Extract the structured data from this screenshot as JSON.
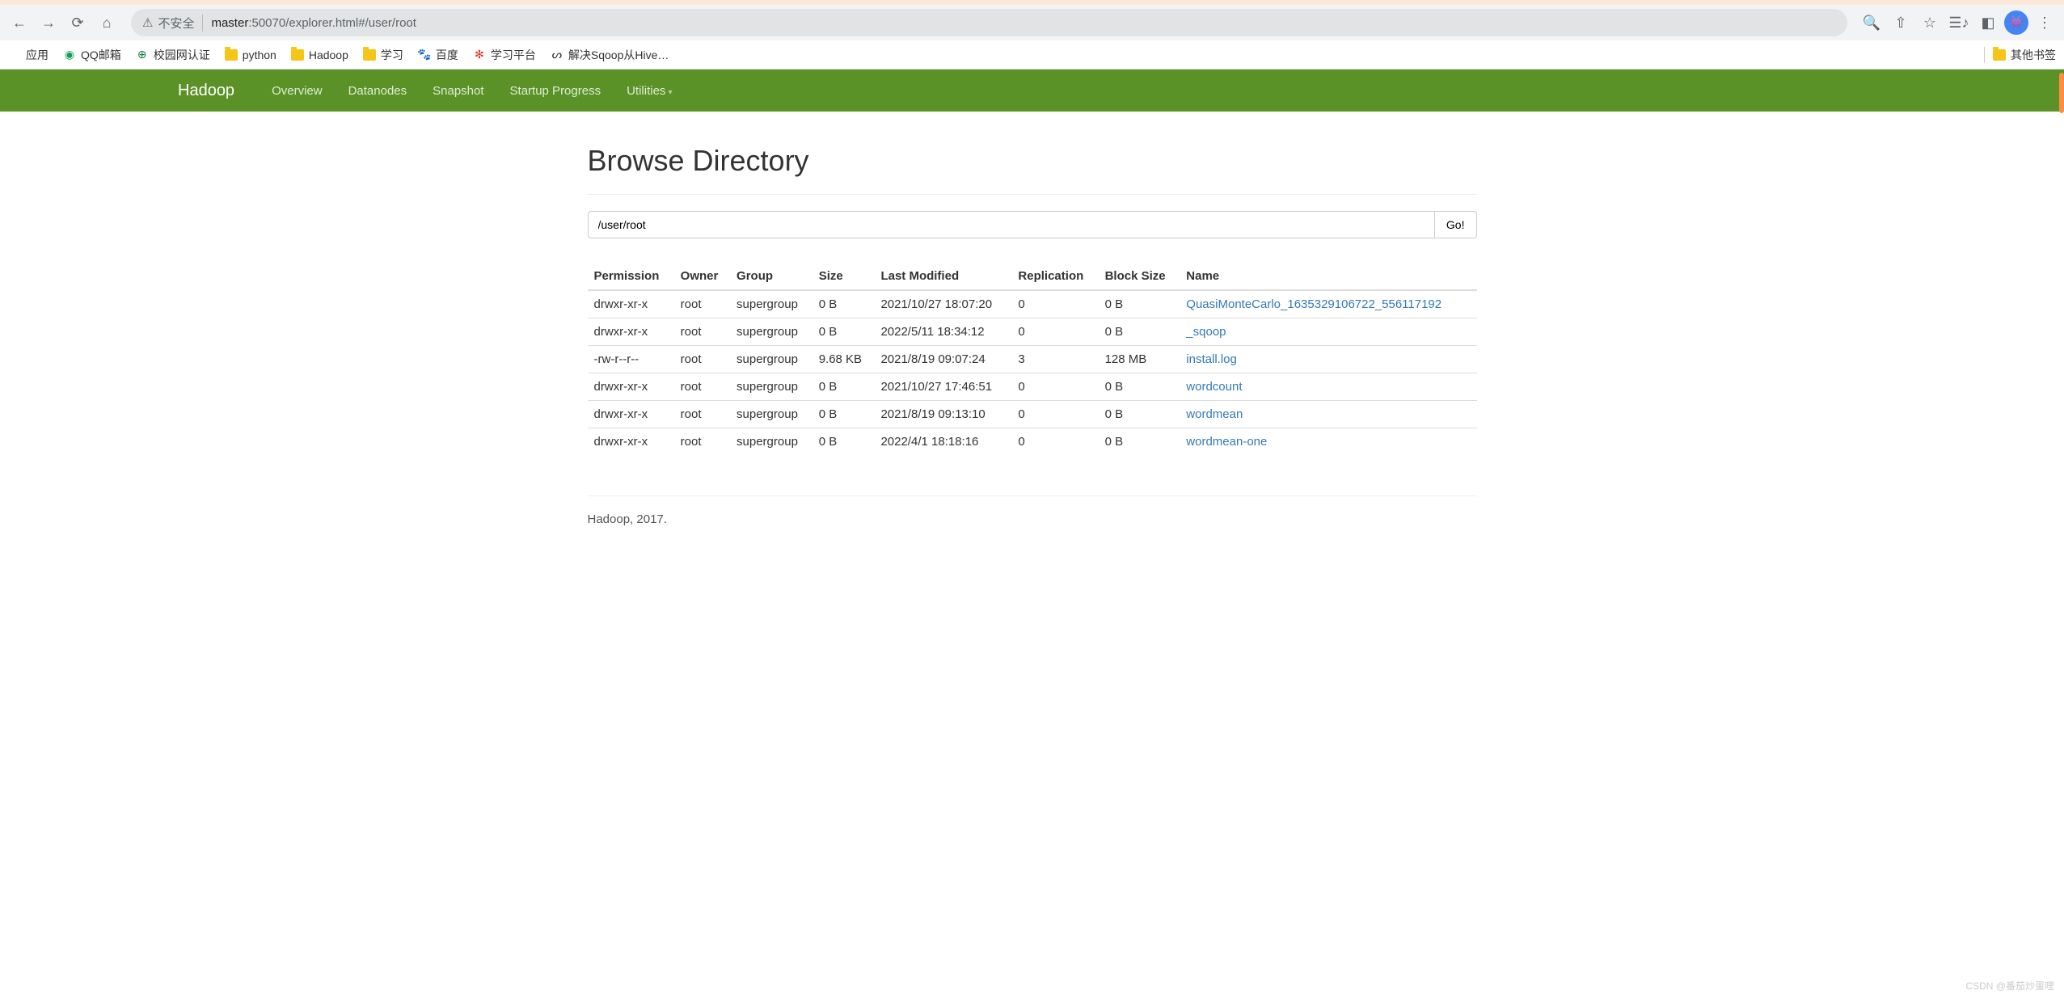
{
  "browser": {
    "insecure_label": "不安全",
    "url_host": "master",
    "url_port_path": ":50070/explorer.html#/user/root"
  },
  "bookmarks": {
    "apps": "应用",
    "items": [
      {
        "label": "QQ邮箱"
      },
      {
        "label": "校园网认证"
      },
      {
        "label": "python"
      },
      {
        "label": "Hadoop"
      },
      {
        "label": "学习"
      },
      {
        "label": "百度"
      },
      {
        "label": "学习平台"
      },
      {
        "label": "解决Sqoop从Hive…"
      }
    ],
    "other": "其他书签"
  },
  "nav": {
    "brand": "Hadoop",
    "items": [
      "Overview",
      "Datanodes",
      "Snapshot",
      "Startup Progress",
      "Utilities"
    ]
  },
  "page": {
    "title": "Browse Directory",
    "path_value": "/user/root",
    "go_label": "Go!"
  },
  "table": {
    "headers": [
      "Permission",
      "Owner",
      "Group",
      "Size",
      "Last Modified",
      "Replication",
      "Block Size",
      "Name"
    ],
    "rows": [
      {
        "perm": "drwxr-xr-x",
        "owner": "root",
        "group": "supergroup",
        "size": "0 B",
        "modified": "2021/10/27 18:07:20",
        "repl": "0",
        "bsize": "0 B",
        "name": "QuasiMonteCarlo_1635329106722_556117192"
      },
      {
        "perm": "drwxr-xr-x",
        "owner": "root",
        "group": "supergroup",
        "size": "0 B",
        "modified": "2022/5/11 18:34:12",
        "repl": "0",
        "bsize": "0 B",
        "name": "_sqoop"
      },
      {
        "perm": "-rw-r--r--",
        "owner": "root",
        "group": "supergroup",
        "size": "9.68 KB",
        "modified": "2021/8/19 09:07:24",
        "repl": "3",
        "bsize": "128 MB",
        "name": "install.log"
      },
      {
        "perm": "drwxr-xr-x",
        "owner": "root",
        "group": "supergroup",
        "size": "0 B",
        "modified": "2021/10/27 17:46:51",
        "repl": "0",
        "bsize": "0 B",
        "name": "wordcount"
      },
      {
        "perm": "drwxr-xr-x",
        "owner": "root",
        "group": "supergroup",
        "size": "0 B",
        "modified": "2021/8/19 09:13:10",
        "repl": "0",
        "bsize": "0 B",
        "name": "wordmean"
      },
      {
        "perm": "drwxr-xr-x",
        "owner": "root",
        "group": "supergroup",
        "size": "0 B",
        "modified": "2022/4/1 18:18:16",
        "repl": "0",
        "bsize": "0 B",
        "name": "wordmean-one"
      }
    ]
  },
  "footer": "Hadoop, 2017.",
  "watermark": "CSDN @番茄炒蛋哩"
}
